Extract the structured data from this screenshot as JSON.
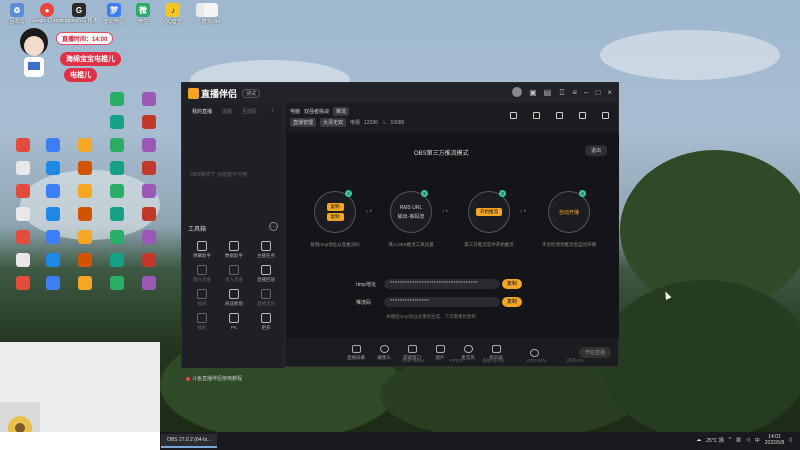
{
  "desktop_icons": [
    {
      "label": "回收站",
      "color": "#5c8cd6",
      "glyph": "♻"
    },
    {
      "label": "Google Chrome",
      "color": "#e8453c",
      "glyph": "●"
    },
    {
      "label": "Logitech G HUB",
      "color": "#2a2a2a",
      "glyph": "G"
    },
    {
      "label": "梦幻伴侣",
      "color": "#3d7ef5",
      "glyph": "梦"
    },
    {
      "label": "微信",
      "color": "#2aae67",
      "glyph": "微"
    },
    {
      "label": "QQ音乐",
      "color": "#f5c623",
      "glyph": "♪"
    },
    {
      "label": "",
      "color": "#e9e9e9",
      "glyph": ""
    },
    {
      "label": "酷狗.net",
      "color": "#f5f5f5",
      "glyph": ""
    }
  ],
  "streamer": {
    "time_badge": "直播时间：14:00",
    "name_badge": "海绵宝宝电棍儿",
    "name_badge2": "电棍儿"
  },
  "app": {
    "name": "直播伴侣",
    "version": "测试",
    "left_tabs": [
      "我的直播",
      "话题",
      "互动区"
    ],
    "empty_text": "OBS推流下 功能暂不可用",
    "toolbox_title": "工具箱",
    "tools": [
      {
        "label": "弹幕助手",
        "dim": false
      },
      {
        "label": "数据助手",
        "dim": false
      },
      {
        "label": "主播任务",
        "dim": false
      },
      {
        "label": "观众连麦",
        "dim": true
      },
      {
        "label": "多人连麦",
        "dim": true
      },
      {
        "label": "直播回放",
        "dim": false
      },
      {
        "label": "福袋",
        "dim": true
      },
      {
        "label": "商品橱窗",
        "dim": false
      },
      {
        "label": "直播活动",
        "dim": true
      },
      {
        "label": "福利",
        "dim": true
      },
      {
        "label": "PK",
        "dim": false
      },
      {
        "label": "更多",
        "dim": false
      }
    ],
    "notice": "斗鱼直播伴侣使用教程",
    "info": {
      "label": "电脑",
      "category": "双强者挑战",
      "chip": "推流",
      "room_tag": "直播管理",
      "room_sub": "大清无双",
      "fans_label": "电视",
      "fans_value": "12336",
      "hot_value": "10085"
    },
    "mode_title": "OBS第三方推流模式",
    "exit_label": "退出",
    "steps": [
      {
        "num": "1",
        "lines": [
          "复制",
          "复制"
        ],
        "desc": "复制rtmp地址以及推流码"
      },
      {
        "num": "2",
        "lines": [
          "RMS URL",
          "输出·串码流"
        ],
        "desc": "填入OBS推流工具设置"
      },
      {
        "num": "3",
        "lines": [
          "开始推流"
        ],
        "desc": "第三方推流软件开始推流"
      },
      {
        "num": "4",
        "lines": [
          "自动开播"
        ],
        "desc": "平台检测到推流后自动开播"
      }
    ],
    "rtmp_label": "rtmp地址",
    "rtmp_value": "************************************",
    "key_label": "推流码",
    "key_value": "****************",
    "copy_label": "复制",
    "hint": "关播后rtmp地址会重新生成，下次需重新复制",
    "controls": [
      "直播屏幕",
      "摄像头",
      "游戏窗口",
      "图片",
      "麦克风",
      "扬声器"
    ],
    "go_live": "开始直播",
    "status": [
      "码率:0kbps",
      "FPS:0",
      "丢帧:0(0%)",
      "CPU:20%",
      "内存:0%"
    ]
  },
  "taskbar": {
    "obs_task": "OBS 27.0.2 (64-bi...",
    "weather": "25°C 阴",
    "time": "14:01",
    "date": "2022/5/8"
  }
}
